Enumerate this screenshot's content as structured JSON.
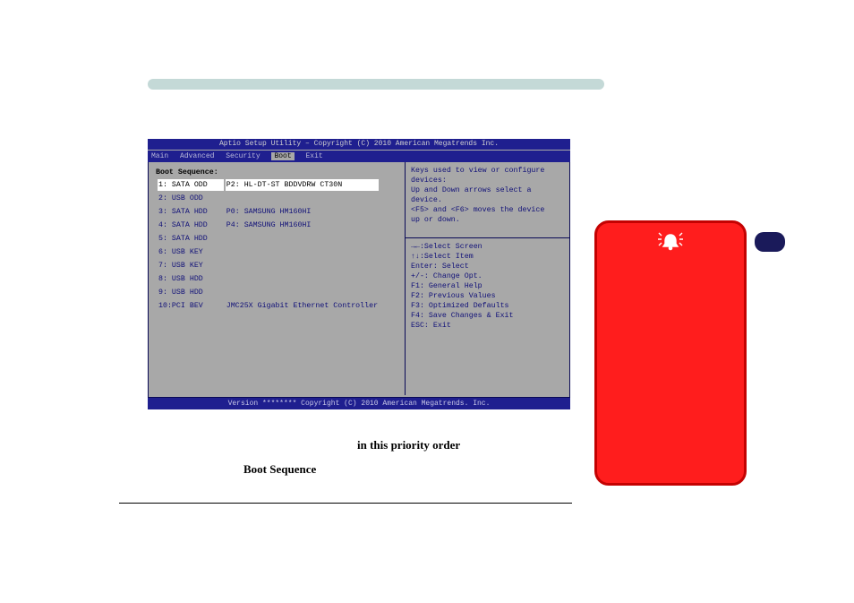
{
  "bios": {
    "header": "Aptio Setup Utility – Copyright (C) 2010 American Megatrends Inc.",
    "tabs": {
      "t1": "Main",
      "t2": "Advanced",
      "t3": "Security",
      "t4": "Boot",
      "t5": "Exit"
    },
    "boot_title": "Boot Sequence:",
    "rows": [
      {
        "idx": "1: SATA ODD",
        "detail": "P2: HL-DT-ST BDDVDRW CT30N",
        "sel": true
      },
      {
        "idx": "2: USB ODD",
        "detail": ""
      },
      {
        "idx": "3: SATA HDD",
        "detail": "P0: SAMSUNG HM160HI"
      },
      {
        "idx": "4: SATA HDD",
        "detail": "P4: SAMSUNG HM160HI"
      },
      {
        "idx": "5: SATA HDD",
        "detail": ""
      },
      {
        "idx": "6: USB KEY",
        "detail": ""
      },
      {
        "idx": "7: USB KEY",
        "detail": ""
      },
      {
        "idx": "8: USB HDD",
        "detail": ""
      },
      {
        "idx": "9: USB HDD",
        "detail": ""
      },
      {
        "idx": "10:PCI BEV",
        "detail": "JMC25X Gigabit Ethernet Controller"
      }
    ],
    "help_top_l1": "Keys used to view or configure",
    "help_top_l2": "devices:",
    "help_top_l3": "Up and Down arrows select a",
    "help_top_l4": "device.",
    "help_top_l5": "<F5> and <F6> moves the device",
    "help_top_l6": "up or down.",
    "help_b1": "→←:Select Screen",
    "help_b2": "↑↓:Select Item",
    "help_b3": "Enter: Select",
    "help_b4": "+/-: Change Opt.",
    "help_b5": "F1: General Help",
    "help_b6": "F2: Previous Values",
    "help_b7": "F3: Optimized Defaults",
    "help_b8": "F4: Save Changes & Exit",
    "help_b9": "ESC: Exit",
    "footer": "Version ******** Copyright (C) 2010 American Megatrends. Inc."
  },
  "captions": {
    "c1": "in this priority order",
    "c2": "Boot Sequence"
  }
}
